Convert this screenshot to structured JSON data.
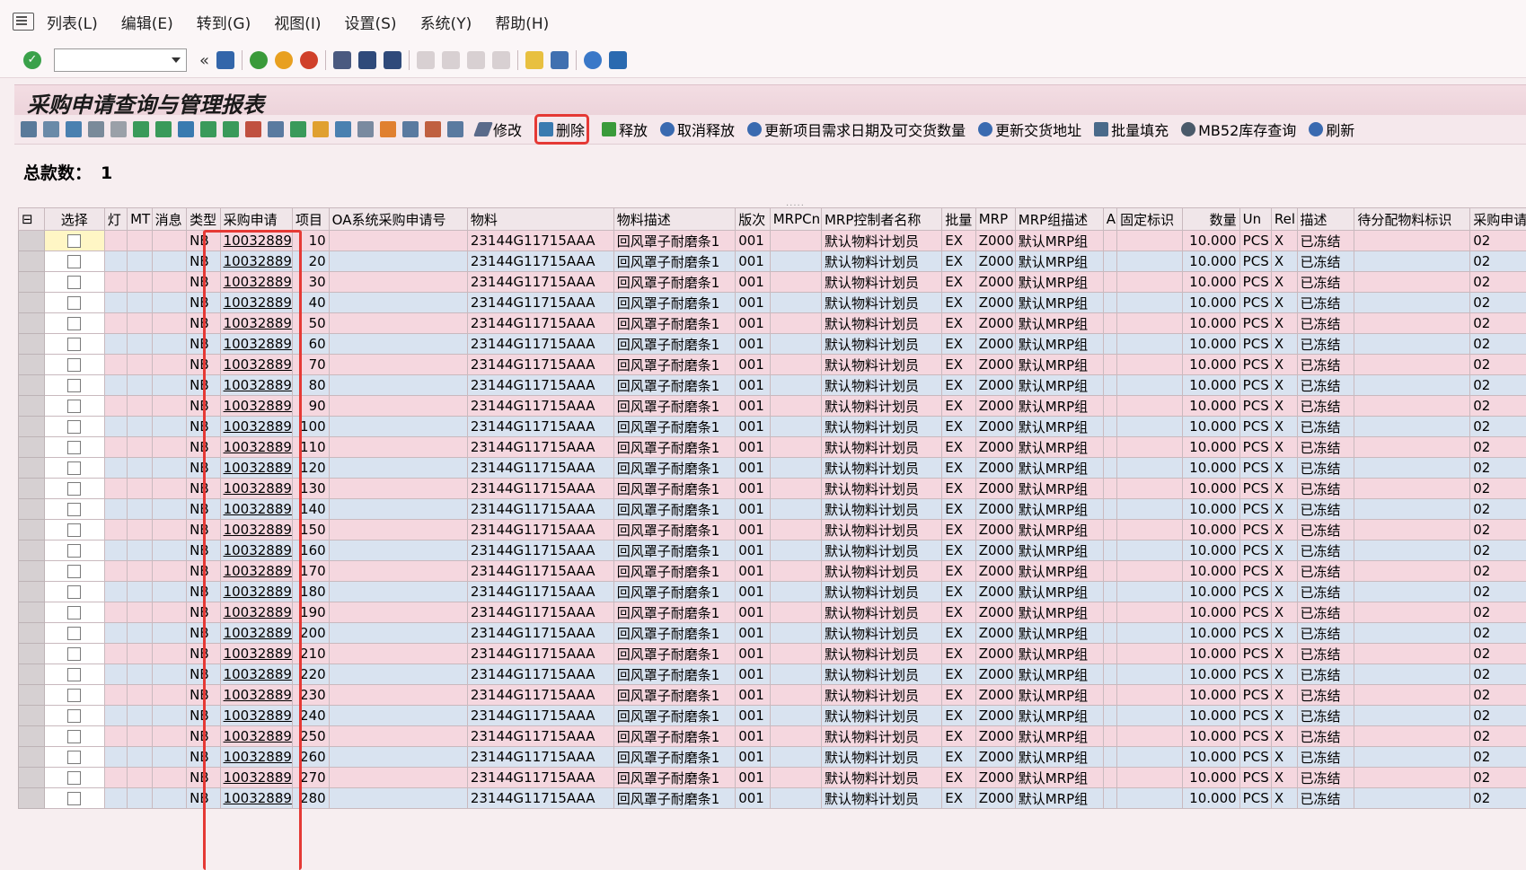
{
  "menu": [
    "列表(L)",
    "编辑(E)",
    "转到(G)",
    "视图(I)",
    "设置(S)",
    "系统(Y)",
    "帮助(H)"
  ],
  "stdbar": {
    "chevron": "«"
  },
  "title": "采购申请查询与管理报表",
  "appbar": {
    "modify": "修改",
    "delete": "删除",
    "release": "释放",
    "cancel_release": "取消释放",
    "update_date_qty": "更新项目需求日期及可交货数量",
    "update_address": "更新交货地址",
    "batch_fill": "批量填充",
    "mb52": "MB52库存查询",
    "refresh": "刷新"
  },
  "total": {
    "label": "总款数：",
    "value": "1"
  },
  "columns": [
    "选择",
    "灯",
    "MT",
    "消息",
    "类型",
    "采购申请",
    "项目",
    "OA系统采购申请号",
    "物料",
    "物料描述",
    "版次",
    "MRPCn",
    "MRP控制者名称",
    "批量",
    "MRP",
    "MRP组描述",
    "A",
    "固定标识",
    "数量",
    "Un",
    "Rel",
    "描述",
    "待分配物料标识",
    "采购申请排"
  ],
  "rows": [
    {
      "type": "NB",
      "pr": "10032889",
      "item": "10",
      "material": "23144G11715AAA",
      "desc": "回风罩子耐磨条1",
      "ver": "001",
      "mrp_ctrl": "默认物料计划员",
      "lot": "EX",
      "mrp": "Z000",
      "mrp_grp": "默认MRP组",
      "qty": "10.000",
      "un": "PCS",
      "rel": "X",
      "status": "已冻结",
      "seq": "02"
    },
    {
      "type": "NB",
      "pr": "10032889",
      "item": "20",
      "material": "23144G11715AAA",
      "desc": "回风罩子耐磨条1",
      "ver": "001",
      "mrp_ctrl": "默认物料计划员",
      "lot": "EX",
      "mrp": "Z000",
      "mrp_grp": "默认MRP组",
      "qty": "10.000",
      "un": "PCS",
      "rel": "X",
      "status": "已冻结",
      "seq": "02"
    },
    {
      "type": "NB",
      "pr": "10032889",
      "item": "30",
      "material": "23144G11715AAA",
      "desc": "回风罩子耐磨条1",
      "ver": "001",
      "mrp_ctrl": "默认物料计划员",
      "lot": "EX",
      "mrp": "Z000",
      "mrp_grp": "默认MRP组",
      "qty": "10.000",
      "un": "PCS",
      "rel": "X",
      "status": "已冻结",
      "seq": "02"
    },
    {
      "type": "NB",
      "pr": "10032889",
      "item": "40",
      "material": "23144G11715AAA",
      "desc": "回风罩子耐磨条1",
      "ver": "001",
      "mrp_ctrl": "默认物料计划员",
      "lot": "EX",
      "mrp": "Z000",
      "mrp_grp": "默认MRP组",
      "qty": "10.000",
      "un": "PCS",
      "rel": "X",
      "status": "已冻结",
      "seq": "02"
    },
    {
      "type": "NB",
      "pr": "10032889",
      "item": "50",
      "material": "23144G11715AAA",
      "desc": "回风罩子耐磨条1",
      "ver": "001",
      "mrp_ctrl": "默认物料计划员",
      "lot": "EX",
      "mrp": "Z000",
      "mrp_grp": "默认MRP组",
      "qty": "10.000",
      "un": "PCS",
      "rel": "X",
      "status": "已冻结",
      "seq": "02"
    },
    {
      "type": "NB",
      "pr": "10032889",
      "item": "60",
      "material": "23144G11715AAA",
      "desc": "回风罩子耐磨条1",
      "ver": "001",
      "mrp_ctrl": "默认物料计划员",
      "lot": "EX",
      "mrp": "Z000",
      "mrp_grp": "默认MRP组",
      "qty": "10.000",
      "un": "PCS",
      "rel": "X",
      "status": "已冻结",
      "seq": "02"
    },
    {
      "type": "NB",
      "pr": "10032889",
      "item": "70",
      "material": "23144G11715AAA",
      "desc": "回风罩子耐磨条1",
      "ver": "001",
      "mrp_ctrl": "默认物料计划员",
      "lot": "EX",
      "mrp": "Z000",
      "mrp_grp": "默认MRP组",
      "qty": "10.000",
      "un": "PCS",
      "rel": "X",
      "status": "已冻结",
      "seq": "02"
    },
    {
      "type": "NB",
      "pr": "10032889",
      "item": "80",
      "material": "23144G11715AAA",
      "desc": "回风罩子耐磨条1",
      "ver": "001",
      "mrp_ctrl": "默认物料计划员",
      "lot": "EX",
      "mrp": "Z000",
      "mrp_grp": "默认MRP组",
      "qty": "10.000",
      "un": "PCS",
      "rel": "X",
      "status": "已冻结",
      "seq": "02"
    },
    {
      "type": "NB",
      "pr": "10032889",
      "item": "90",
      "material": "23144G11715AAA",
      "desc": "回风罩子耐磨条1",
      "ver": "001",
      "mrp_ctrl": "默认物料计划员",
      "lot": "EX",
      "mrp": "Z000",
      "mrp_grp": "默认MRP组",
      "qty": "10.000",
      "un": "PCS",
      "rel": "X",
      "status": "已冻结",
      "seq": "02"
    },
    {
      "type": "NB",
      "pr": "10032889",
      "item": "100",
      "material": "23144G11715AAA",
      "desc": "回风罩子耐磨条1",
      "ver": "001",
      "mrp_ctrl": "默认物料计划员",
      "lot": "EX",
      "mrp": "Z000",
      "mrp_grp": "默认MRP组",
      "qty": "10.000",
      "un": "PCS",
      "rel": "X",
      "status": "已冻结",
      "seq": "02"
    },
    {
      "type": "NB",
      "pr": "10032889",
      "item": "110",
      "material": "23144G11715AAA",
      "desc": "回风罩子耐磨条1",
      "ver": "001",
      "mrp_ctrl": "默认物料计划员",
      "lot": "EX",
      "mrp": "Z000",
      "mrp_grp": "默认MRP组",
      "qty": "10.000",
      "un": "PCS",
      "rel": "X",
      "status": "已冻结",
      "seq": "02"
    },
    {
      "type": "NB",
      "pr": "10032889",
      "item": "120",
      "material": "23144G11715AAA",
      "desc": "回风罩子耐磨条1",
      "ver": "001",
      "mrp_ctrl": "默认物料计划员",
      "lot": "EX",
      "mrp": "Z000",
      "mrp_grp": "默认MRP组",
      "qty": "10.000",
      "un": "PCS",
      "rel": "X",
      "status": "已冻结",
      "seq": "02"
    },
    {
      "type": "NB",
      "pr": "10032889",
      "item": "130",
      "material": "23144G11715AAA",
      "desc": "回风罩子耐磨条1",
      "ver": "001",
      "mrp_ctrl": "默认物料计划员",
      "lot": "EX",
      "mrp": "Z000",
      "mrp_grp": "默认MRP组",
      "qty": "10.000",
      "un": "PCS",
      "rel": "X",
      "status": "已冻结",
      "seq": "02"
    },
    {
      "type": "NB",
      "pr": "10032889",
      "item": "140",
      "material": "23144G11715AAA",
      "desc": "回风罩子耐磨条1",
      "ver": "001",
      "mrp_ctrl": "默认物料计划员",
      "lot": "EX",
      "mrp": "Z000",
      "mrp_grp": "默认MRP组",
      "qty": "10.000",
      "un": "PCS",
      "rel": "X",
      "status": "已冻结",
      "seq": "02"
    },
    {
      "type": "NB",
      "pr": "10032889",
      "item": "150",
      "material": "23144G11715AAA",
      "desc": "回风罩子耐磨条1",
      "ver": "001",
      "mrp_ctrl": "默认物料计划员",
      "lot": "EX",
      "mrp": "Z000",
      "mrp_grp": "默认MRP组",
      "qty": "10.000",
      "un": "PCS",
      "rel": "X",
      "status": "已冻结",
      "seq": "02"
    },
    {
      "type": "NB",
      "pr": "10032889",
      "item": "160",
      "material": "23144G11715AAA",
      "desc": "回风罩子耐磨条1",
      "ver": "001",
      "mrp_ctrl": "默认物料计划员",
      "lot": "EX",
      "mrp": "Z000",
      "mrp_grp": "默认MRP组",
      "qty": "10.000",
      "un": "PCS",
      "rel": "X",
      "status": "已冻结",
      "seq": "02"
    },
    {
      "type": "NB",
      "pr": "10032889",
      "item": "170",
      "material": "23144G11715AAA",
      "desc": "回风罩子耐磨条1",
      "ver": "001",
      "mrp_ctrl": "默认物料计划员",
      "lot": "EX",
      "mrp": "Z000",
      "mrp_grp": "默认MRP组",
      "qty": "10.000",
      "un": "PCS",
      "rel": "X",
      "status": "已冻结",
      "seq": "02"
    },
    {
      "type": "NB",
      "pr": "10032889",
      "item": "180",
      "material": "23144G11715AAA",
      "desc": "回风罩子耐磨条1",
      "ver": "001",
      "mrp_ctrl": "默认物料计划员",
      "lot": "EX",
      "mrp": "Z000",
      "mrp_grp": "默认MRP组",
      "qty": "10.000",
      "un": "PCS",
      "rel": "X",
      "status": "已冻结",
      "seq": "02"
    },
    {
      "type": "NB",
      "pr": "10032889",
      "item": "190",
      "material": "23144G11715AAA",
      "desc": "回风罩子耐磨条1",
      "ver": "001",
      "mrp_ctrl": "默认物料计划员",
      "lot": "EX",
      "mrp": "Z000",
      "mrp_grp": "默认MRP组",
      "qty": "10.000",
      "un": "PCS",
      "rel": "X",
      "status": "已冻结",
      "seq": "02"
    },
    {
      "type": "NB",
      "pr": "10032889",
      "item": "200",
      "material": "23144G11715AAA",
      "desc": "回风罩子耐磨条1",
      "ver": "001",
      "mrp_ctrl": "默认物料计划员",
      "lot": "EX",
      "mrp": "Z000",
      "mrp_grp": "默认MRP组",
      "qty": "10.000",
      "un": "PCS",
      "rel": "X",
      "status": "已冻结",
      "seq": "02"
    },
    {
      "type": "NB",
      "pr": "10032889",
      "item": "210",
      "material": "23144G11715AAA",
      "desc": "回风罩子耐磨条1",
      "ver": "001",
      "mrp_ctrl": "默认物料计划员",
      "lot": "EX",
      "mrp": "Z000",
      "mrp_grp": "默认MRP组",
      "qty": "10.000",
      "un": "PCS",
      "rel": "X",
      "status": "已冻结",
      "seq": "02"
    },
    {
      "type": "NB",
      "pr": "10032889",
      "item": "220",
      "material": "23144G11715AAA",
      "desc": "回风罩子耐磨条1",
      "ver": "001",
      "mrp_ctrl": "默认物料计划员",
      "lot": "EX",
      "mrp": "Z000",
      "mrp_grp": "默认MRP组",
      "qty": "10.000",
      "un": "PCS",
      "rel": "X",
      "status": "已冻结",
      "seq": "02"
    },
    {
      "type": "NB",
      "pr": "10032889",
      "item": "230",
      "material": "23144G11715AAA",
      "desc": "回风罩子耐磨条1",
      "ver": "001",
      "mrp_ctrl": "默认物料计划员",
      "lot": "EX",
      "mrp": "Z000",
      "mrp_grp": "默认MRP组",
      "qty": "10.000",
      "un": "PCS",
      "rel": "X",
      "status": "已冻结",
      "seq": "02"
    },
    {
      "type": "NB",
      "pr": "10032889",
      "item": "240",
      "material": "23144G11715AAA",
      "desc": "回风罩子耐磨条1",
      "ver": "001",
      "mrp_ctrl": "默认物料计划员",
      "lot": "EX",
      "mrp": "Z000",
      "mrp_grp": "默认MRP组",
      "qty": "10.000",
      "un": "PCS",
      "rel": "X",
      "status": "已冻结",
      "seq": "02"
    },
    {
      "type": "NB",
      "pr": "10032889",
      "item": "250",
      "material": "23144G11715AAA",
      "desc": "回风罩子耐磨条1",
      "ver": "001",
      "mrp_ctrl": "默认物料计划员",
      "lot": "EX",
      "mrp": "Z000",
      "mrp_grp": "默认MRP组",
      "qty": "10.000",
      "un": "PCS",
      "rel": "X",
      "status": "已冻结",
      "seq": "02"
    },
    {
      "type": "NB",
      "pr": "10032889",
      "item": "260",
      "material": "23144G11715AAA",
      "desc": "回风罩子耐磨条1",
      "ver": "001",
      "mrp_ctrl": "默认物料计划员",
      "lot": "EX",
      "mrp": "Z000",
      "mrp_grp": "默认MRP组",
      "qty": "10.000",
      "un": "PCS",
      "rel": "X",
      "status": "已冻结",
      "seq": "02"
    },
    {
      "type": "NB",
      "pr": "10032889",
      "item": "270",
      "material": "23144G11715AAA",
      "desc": "回风罩子耐磨条1",
      "ver": "001",
      "mrp_ctrl": "默认物料计划员",
      "lot": "EX",
      "mrp": "Z000",
      "mrp_grp": "默认MRP组",
      "qty": "10.000",
      "un": "PCS",
      "rel": "X",
      "status": "已冻结",
      "seq": "02"
    },
    {
      "type": "NB",
      "pr": "10032889",
      "item": "280",
      "material": "23144G11715AAA",
      "desc": "回风罩子耐磨条1",
      "ver": "001",
      "mrp_ctrl": "默认物料计划员",
      "lot": "EX",
      "mrp": "Z000",
      "mrp_grp": "默认MRP组",
      "qty": "10.000",
      "un": "PCS",
      "rel": "X",
      "status": "已冻结",
      "seq": "02"
    }
  ]
}
